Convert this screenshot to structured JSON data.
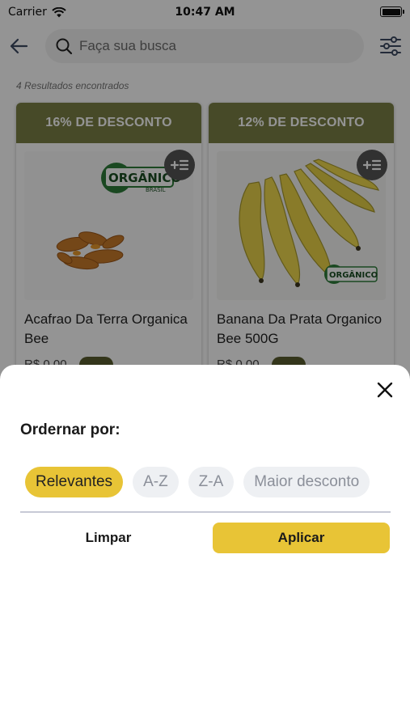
{
  "status_bar": {
    "carrier": "Carrier",
    "time": "10:47 AM",
    "icons": [
      "wifi-icon",
      "battery-icon"
    ]
  },
  "header": {
    "search_placeholder": "Faça sua busca",
    "icons": [
      "back-arrow-icon",
      "search-icon",
      "filter-sliders-icon"
    ]
  },
  "results": {
    "count_text": "4 Resultados encontrados"
  },
  "products": [
    {
      "discount": "16% DE DESCONTO",
      "name": "Acafrao Da Terra Organica Bee",
      "price": "R$ 0,00",
      "image": "turmeric-root",
      "badge": "organico-brasil-seal"
    },
    {
      "discount": "12% DE DESCONTO",
      "name": "Banana Da Prata Organico Bee 500G",
      "price": "R$ 0,00",
      "image": "banana-bunch",
      "badge": "organico-brasil-seal"
    }
  ],
  "sheet": {
    "title": "Ordernar por:",
    "options": [
      {
        "label": "Relevantes",
        "selected": true
      },
      {
        "label": "A-Z",
        "selected": false
      },
      {
        "label": "Z-A",
        "selected": false
      },
      {
        "label": "Maior desconto",
        "selected": false
      }
    ],
    "clear_label": "Limpar",
    "apply_label": "Aplicar"
  },
  "colors": {
    "accent": "#e8c436",
    "discount_band": "#7a8046",
    "chip_inactive_bg": "#eef0f3",
    "chip_inactive_text": "#8b8f99",
    "overlay": "rgba(0,0,0,0.42)"
  }
}
